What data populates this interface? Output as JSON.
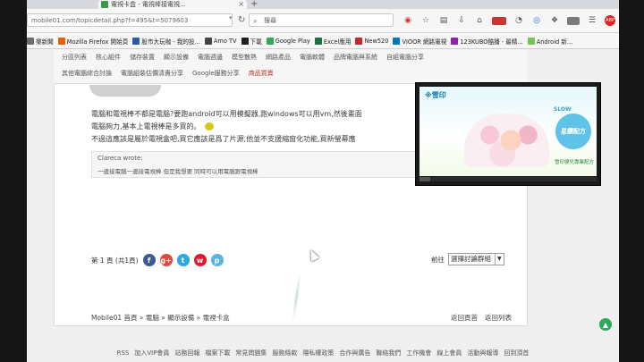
{
  "browser": {
    "tab_title": "電視卡盒 - 電視棒接電視...",
    "url": "mobile01.com/topicdetail.php?f=495&t=5079603",
    "search_placeholder": "搜尋"
  },
  "bookmarks": [
    {
      "label": "樂新聞",
      "color": "#6d6d6d"
    },
    {
      "label": "Mozilla Firefox 開始頁",
      "color": "#e66000"
    },
    {
      "label": "股市大玩咖 - 我的投...",
      "color": "#2d5aa0"
    },
    {
      "label": "Amo TV",
      "color": "#444"
    },
    {
      "label": "下載",
      "color": "#1f1f1f"
    },
    {
      "label": "Google Play",
      "color": "#34a853"
    },
    {
      "label": "Excel應用",
      "color": "#1d6f42"
    },
    {
      "label": "New520",
      "color": "#c62828"
    },
    {
      "label": "VIOOR 網路電視",
      "color": "#0277bd"
    },
    {
      "label": "123KUBO酷播 - 最精...",
      "color": "#8e24aa"
    },
    {
      "label": "Android 新...",
      "color": "#78c257"
    }
  ],
  "subnav": {
    "row1": [
      "分區列表",
      "核心組件",
      "儲存裝置",
      "顯示設備",
      "電腦週邊",
      "模型散熱",
      "網路產品",
      "電腦軟體",
      "品牌電腦與系統",
      "自組電腦分享"
    ],
    "row2": [
      "其他電腦綜合討論",
      "電腦組裝估價清責分享",
      "Google服務分享"
    ],
    "row2_hot": "商品買賣"
  },
  "post": {
    "line1": "電腦和電視棒不都是電腦?要跑android可以用模擬器,跑windows可以用vm,然後畫面",
    "line2": "電腦夠力,基本上電視棒是多買的。",
    "line3": "不過這應該是屬於電視盒吧,買它應該是爲了片源,他並不支援縮窗化功能,買新螢幕應"
  },
  "quote": {
    "author": "Clareca wrote:",
    "text": "一邊接電腦一邊接電視棒 但是我想要 同時可以用電腦跟電視棒"
  },
  "video_ad": {
    "brand": "※雪印",
    "slow_label": "SLOW",
    "badge": "星鑽配方",
    "caption": "雪印嬰兒專業配方"
  },
  "pager": {
    "label": "第 1 頁 (共1頁)",
    "goto_label": "前往",
    "select_value": "選擇討論群組"
  },
  "social_icons": [
    "f",
    "g+",
    "t",
    "w",
    "p"
  ],
  "breadcrumb": "Mobile01 首頁 » 電腦 » 顯示設備 » 電視卡盒",
  "back_links": [
    "返回頁首",
    "返回列表"
  ],
  "footer": [
    "RSS",
    "加入VIP會員",
    "站務回報",
    "檔案下載",
    "常見問題集",
    "服務條款",
    "隱私權政策",
    "合作與廣告",
    "聯絡我們",
    "工作機會",
    "線上會員",
    "活動與報導",
    "回到頂首"
  ],
  "colors": {
    "accent": "#c0392b",
    "link": "#444444"
  }
}
